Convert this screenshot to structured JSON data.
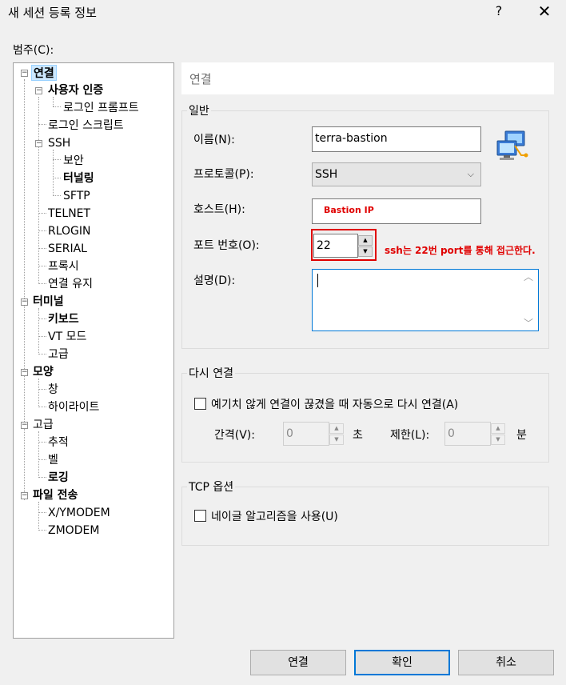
{
  "window": {
    "title": "새 세션 등록 정보",
    "help_glyph": "?",
    "close_glyph": "✕"
  },
  "category_label": "범주(C):",
  "tree": {
    "items": [
      {
        "label": "연결",
        "bold": true
      },
      {
        "label": "사용자 인증",
        "bold": true
      },
      {
        "label": "로그인 프롬프트",
        "bold": false
      },
      {
        "label": "로그인 스크립트",
        "bold": false
      },
      {
        "label": "SSH",
        "bold": false
      },
      {
        "label": "보안",
        "bold": false
      },
      {
        "label": "터널링",
        "bold": true
      },
      {
        "label": "SFTP",
        "bold": false
      },
      {
        "label": "TELNET",
        "bold": false
      },
      {
        "label": "RLOGIN",
        "bold": false
      },
      {
        "label": "SERIAL",
        "bold": false
      },
      {
        "label": "프록시",
        "bold": false
      },
      {
        "label": "연결 유지",
        "bold": false
      },
      {
        "label": "터미널",
        "bold": true
      },
      {
        "label": "키보드",
        "bold": true
      },
      {
        "label": "VT 모드",
        "bold": false
      },
      {
        "label": "고급",
        "bold": false
      },
      {
        "label": "모양",
        "bold": true
      },
      {
        "label": "창",
        "bold": false
      },
      {
        "label": "하이라이트",
        "bold": false
      },
      {
        "label": "고급",
        "bold": false
      },
      {
        "label": "추적",
        "bold": false
      },
      {
        "label": "벨",
        "bold": false
      },
      {
        "label": "로깅",
        "bold": true
      },
      {
        "label": "파일 전송",
        "bold": true
      },
      {
        "label": "X/YMODEM",
        "bold": false
      },
      {
        "label": "ZMODEM",
        "bold": false
      }
    ],
    "expander_glyph": "−"
  },
  "header": {
    "title": "연결"
  },
  "general": {
    "group_title": "일반",
    "name_label": "이름(N):",
    "name_value": "terra-bastion",
    "protocol_label": "프로토콜(P):",
    "protocol_value": "SSH",
    "host_label": "호스트(H):",
    "host_value": "Bastion IP",
    "port_label": "포트 번호(O):",
    "port_value": "22",
    "description_label": "설명(D):",
    "description_value": ""
  },
  "annotation": "ssh는 22번 port를 통해 접근한다.",
  "reconnect": {
    "group_title": "다시 연결",
    "checkbox_label": "예기치 않게 연결이 끊겼을 때 자동으로 다시 연결(A)",
    "interval_label": "간격(V):",
    "interval_value": "0",
    "interval_unit": "초",
    "limit_label": "제한(L):",
    "limit_value": "0",
    "limit_unit": "분"
  },
  "tcp": {
    "group_title": "TCP 옵션",
    "nagle_label": "네이글 알고리즘을 사용(U)"
  },
  "buttons": {
    "connect": "연결",
    "ok": "확인",
    "cancel": "취소"
  },
  "glyphs": {
    "up": "▲",
    "down": "▼",
    "combo_arrow": "⌵",
    "scroll_up": "︿",
    "scroll_down": "﹀"
  },
  "colors": {
    "annotation": "#e00000",
    "selection": "#cce8ff",
    "default_button_border": "#0078d7"
  }
}
